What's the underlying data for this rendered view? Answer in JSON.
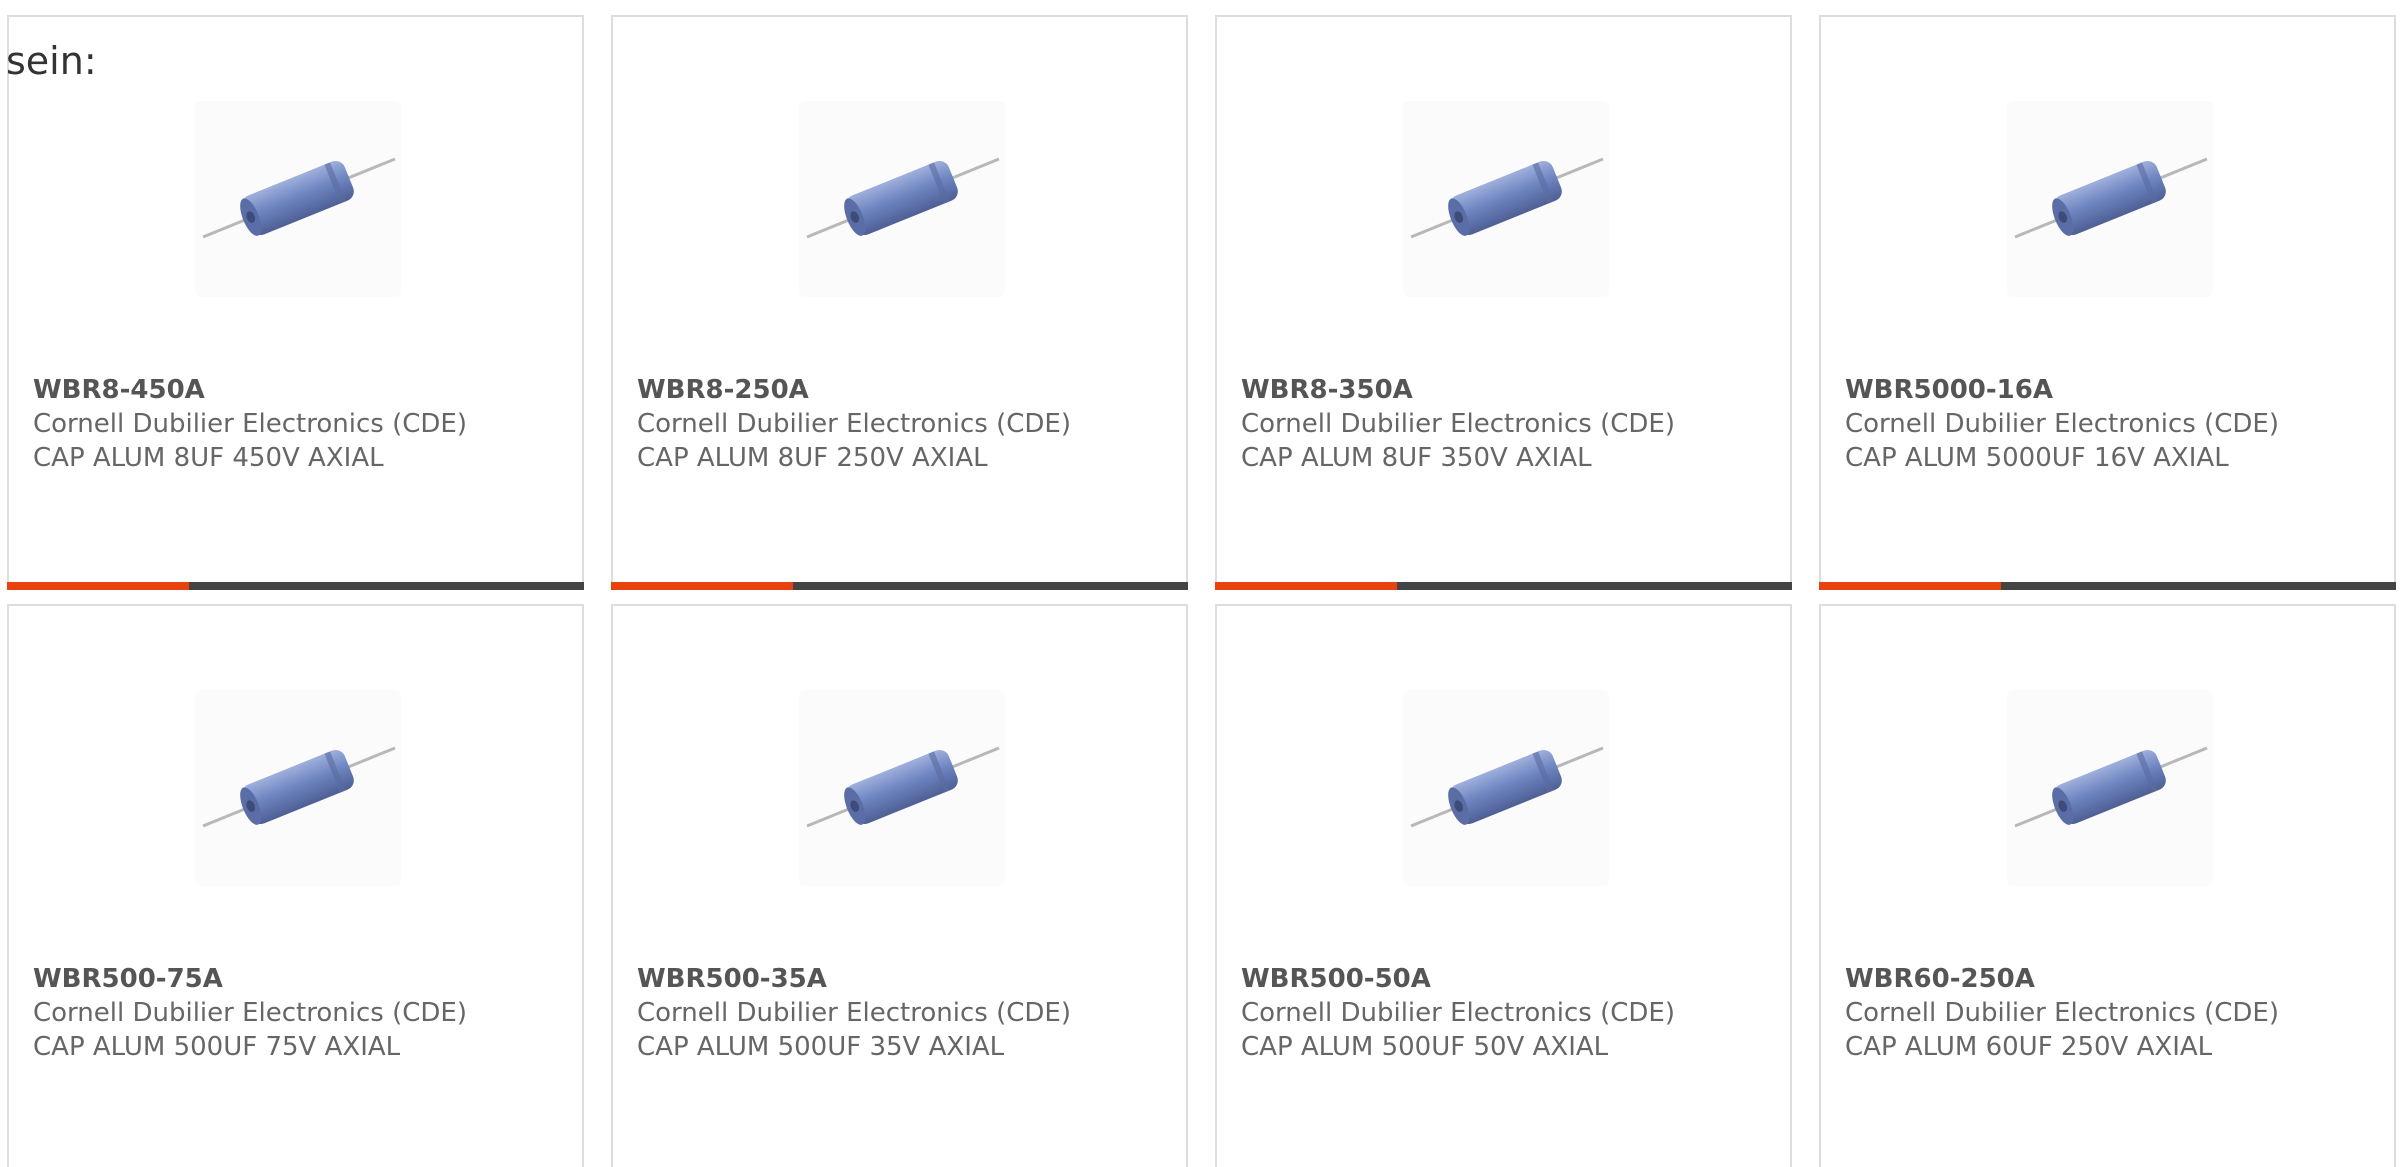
{
  "intro_text": "sein:",
  "colors": {
    "accent": "#e8430f",
    "bar_dark": "#444444",
    "card_border": "#dddddd",
    "capacitor_body": "#6f86c2"
  },
  "products": [
    {
      "part": "WBR8-450A",
      "manufacturer": "Cornell Dubilier Electronics (CDE)",
      "description": "CAP ALUM 8UF 450V AXIAL",
      "image_icon": "capacitor-image"
    },
    {
      "part": "WBR8-250A",
      "manufacturer": "Cornell Dubilier Electronics (CDE)",
      "description": "CAP ALUM 8UF 250V AXIAL",
      "image_icon": "capacitor-image"
    },
    {
      "part": "WBR8-350A",
      "manufacturer": "Cornell Dubilier Electronics (CDE)",
      "description": "CAP ALUM 8UF 350V AXIAL",
      "image_icon": "capacitor-image"
    },
    {
      "part": "WBR5000-16A",
      "manufacturer": "Cornell Dubilier Electronics (CDE)",
      "description": "CAP ALUM 5000UF 16V AXIAL",
      "image_icon": "capacitor-image"
    },
    {
      "part": "WBR500-75A",
      "manufacturer": "Cornell Dubilier Electronics (CDE)",
      "description": "CAP ALUM 500UF 75V AXIAL",
      "image_icon": "capacitor-image"
    },
    {
      "part": "WBR500-35A",
      "manufacturer": "Cornell Dubilier Electronics (CDE)",
      "description": "CAP ALUM 500UF 35V AXIAL",
      "image_icon": "capacitor-image"
    },
    {
      "part": "WBR500-50A",
      "manufacturer": "Cornell Dubilier Electronics (CDE)",
      "description": "CAP ALUM 500UF 50V AXIAL",
      "image_icon": "capacitor-image"
    },
    {
      "part": "WBR60-250A",
      "manufacturer": "Cornell Dubilier Electronics (CDE)",
      "description": "CAP ALUM 60UF 250V AXIAL",
      "image_icon": "capacitor-image"
    }
  ]
}
